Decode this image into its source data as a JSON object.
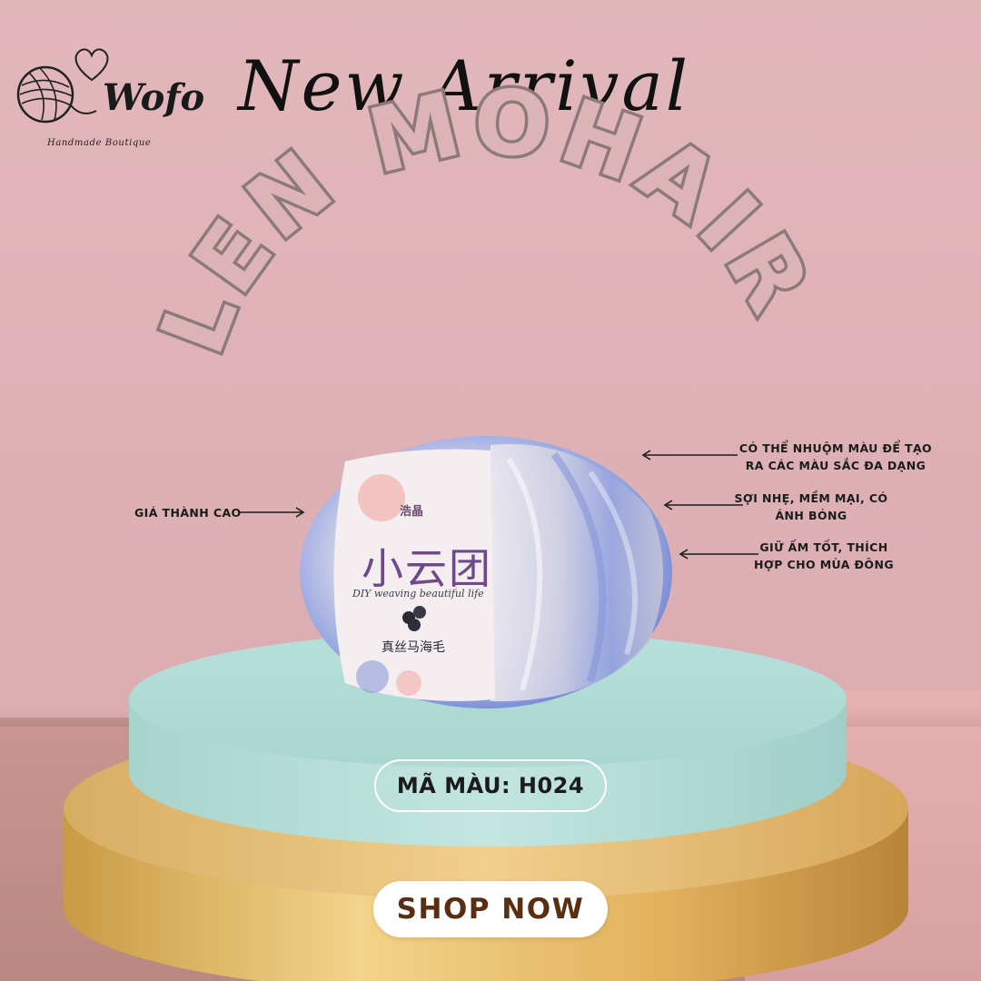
{
  "brand": {
    "name": "Wofo",
    "tagline": "Handmade Boutique"
  },
  "headline": "New Arrival",
  "product_title": "LEN MOHAIR",
  "yarn_label": {
    "brand_mark": "浩晶",
    "name_cn": "小云团",
    "slogan": "DIY weaving beautiful life",
    "material_cn": "真丝马海毛"
  },
  "callouts": {
    "price": "GIÁ THÀNH CAO",
    "dye_line1": "CÓ THỂ NHUỘM MÀU ĐỂ TẠO",
    "dye_line2": "RA CÁC MÀU SẮC ĐA DẠNG",
    "soft_line1": "SỢI NHẸ, MỀM MẠI, CÓ",
    "soft_line2": "ÁNH BÓNG",
    "warm_line1": "GIỮ ẤM TỐT, THÍCH",
    "warm_line2": "HỢP CHO MÙA ĐÔNG"
  },
  "color_code": "MÃ MÀU: H024",
  "cta": "SHOP NOW",
  "colors": {
    "background": "#ddb0b6",
    "title_outline": "#8c7a7a",
    "title_fill": "#dcb3b7",
    "podium_top": "#b3dcd6",
    "podium_gold": "#e8bd6a",
    "cta_text": "#5a2e12",
    "yarn_blue": "#8ea0e0"
  },
  "icons": [
    "yarn-ball-logo-icon",
    "heart-icon",
    "arrow-left-icon",
    "arrow-right-icon"
  ]
}
